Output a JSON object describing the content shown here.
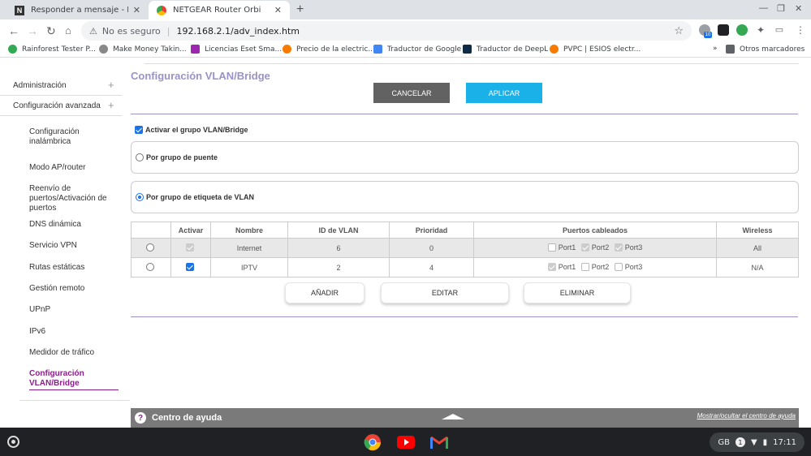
{
  "browser": {
    "tabs": [
      {
        "title": "Responder a mensaje - NETGEAR",
        "favicon": "N"
      },
      {
        "title": "NETGEAR Router Orbi",
        "favicon": "chrome"
      }
    ],
    "address": {
      "security": "No es seguro",
      "url": "192.168.2.1/adv_index.htm"
    },
    "bookmarks": [
      {
        "label": "Rainforest Tester P...",
        "color": "#34a853"
      },
      {
        "label": "Make Money Takin...",
        "color": "#888888"
      },
      {
        "label": "Licencias Eset Sma...",
        "color": "#9c27b0"
      },
      {
        "label": "Precio de la electric...",
        "color": "#f57c00"
      },
      {
        "label": "Traductor de Google",
        "color": "#4285f4"
      },
      {
        "label": "Traductor de DeepL",
        "color": "#0f2b46"
      },
      {
        "label": "PVPC | ESIOS electr...",
        "color": "#f57c00"
      }
    ],
    "bookmarks_more": "»",
    "other_bookmarks": "Otros marcadores",
    "ext_badge": "10"
  },
  "sidebar": {
    "top": [
      "Administración",
      "Configuración avanzada"
    ],
    "items": [
      "Configuración inalámbrica",
      "Modo AP/router",
      "Reenvío de puertos/Activación de puertos",
      "DNS dinámica",
      "Servicio VPN",
      "Rutas estáticas",
      "Gestión remoto",
      "UPnP",
      "IPv6",
      "Medidor de tráfico",
      "Configuración VLAN/Bridge"
    ]
  },
  "main": {
    "title": "Configuración VLAN/Bridge",
    "cancel": "CANCELAR",
    "apply": "APLICAR",
    "enable_label": "Activar el grupo VLAN/Bridge",
    "bridge_label": "Por grupo de puente",
    "vlan_label": "Por grupo de etiqueta de VLAN",
    "table": {
      "headers": [
        "",
        "Activar",
        "Nombre",
        "ID de VLAN",
        "Prioridad",
        "Puertos cableados",
        "Wireless"
      ],
      "rows": [
        {
          "name": "Internet",
          "vlan_id": "6",
          "priority": "0",
          "ports": [
            "Port1",
            "Port2",
            "Port3"
          ],
          "wireless": "All"
        },
        {
          "name": "IPTV",
          "vlan_id": "2",
          "priority": "4",
          "ports": [
            "Port1",
            "Port2",
            "Port3"
          ],
          "wireless": "N/A"
        }
      ]
    },
    "add": "AÑADIR",
    "edit": "EDITAR",
    "delete": "ELIMINAR"
  },
  "help": {
    "title": "Centro de ayuda",
    "toggle": "Mostrar/ocultar el centro de ayuda",
    "icon": "?"
  },
  "shelf": {
    "locale": "GB",
    "notif": "1",
    "time": "17:11"
  }
}
